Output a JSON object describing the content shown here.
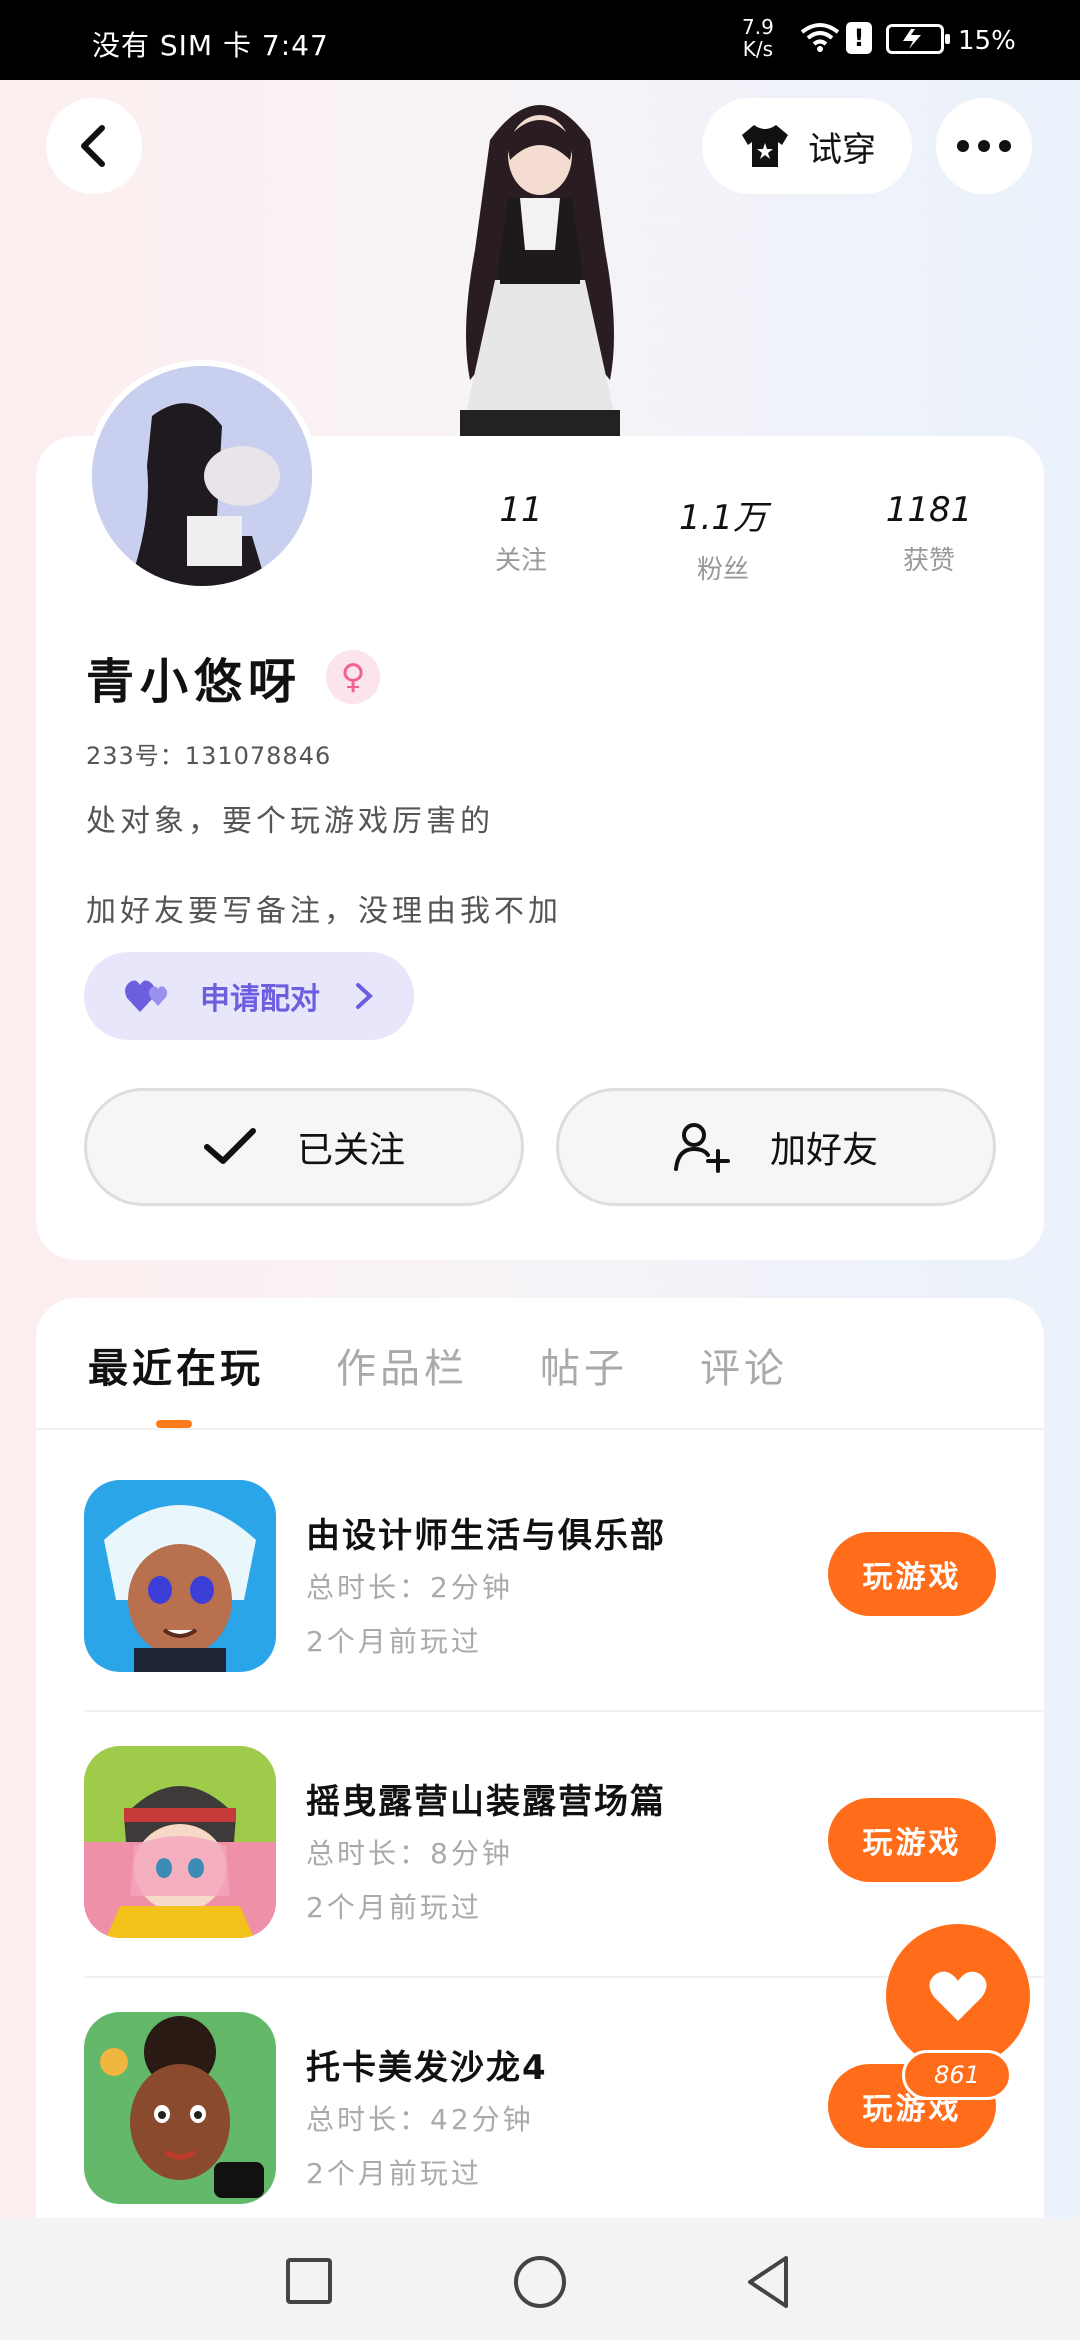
{
  "status_bar": {
    "carrier": "没有 SIM 卡",
    "time": "7:47",
    "net_speed_value": "7.9",
    "net_speed_unit": "K/s",
    "battery": "15%"
  },
  "header": {
    "try_on_label": "试穿"
  },
  "profile": {
    "stats": [
      {
        "value": "11",
        "label": "关注"
      },
      {
        "value": "1.1万",
        "label": "粉丝"
      },
      {
        "value": "1181",
        "label": "获赞"
      }
    ],
    "name": "青小悠呀",
    "gender_symbol": "♀",
    "uid": "233号：131078846",
    "bio_line1": "处对象，要个玩游戏厉害的",
    "bio_line2": "加好友要写备注，没理由我不加",
    "pair_label": "申请配对",
    "follow_label": "已关注",
    "add_friend_label": "加好友"
  },
  "tabs": [
    {
      "label": "最近在玩",
      "active": true
    },
    {
      "label": "作品栏",
      "active": false
    },
    {
      "label": "帖子",
      "active": false
    },
    {
      "label": "评论",
      "active": false
    }
  ],
  "games": [
    {
      "title": "由设计师生活与俱乐部",
      "duration": "总时长：2分钟",
      "last_played": "2个月前玩过",
      "play_label": "玩游戏"
    },
    {
      "title": "摇曳露营山装露营场篇",
      "duration": "总时长：8分钟",
      "last_played": "2个月前玩过",
      "play_label": "玩游戏"
    },
    {
      "title": "托卡美发沙龙4",
      "duration": "总时长：42分钟",
      "last_played": "2个月前玩过",
      "play_label": "玩游戏"
    }
  ],
  "likes": {
    "count": "861"
  },
  "colors": {
    "accent": "#ff6d1a",
    "pair_purple": "#6b5fe0",
    "gender_pink": "#f06292"
  }
}
